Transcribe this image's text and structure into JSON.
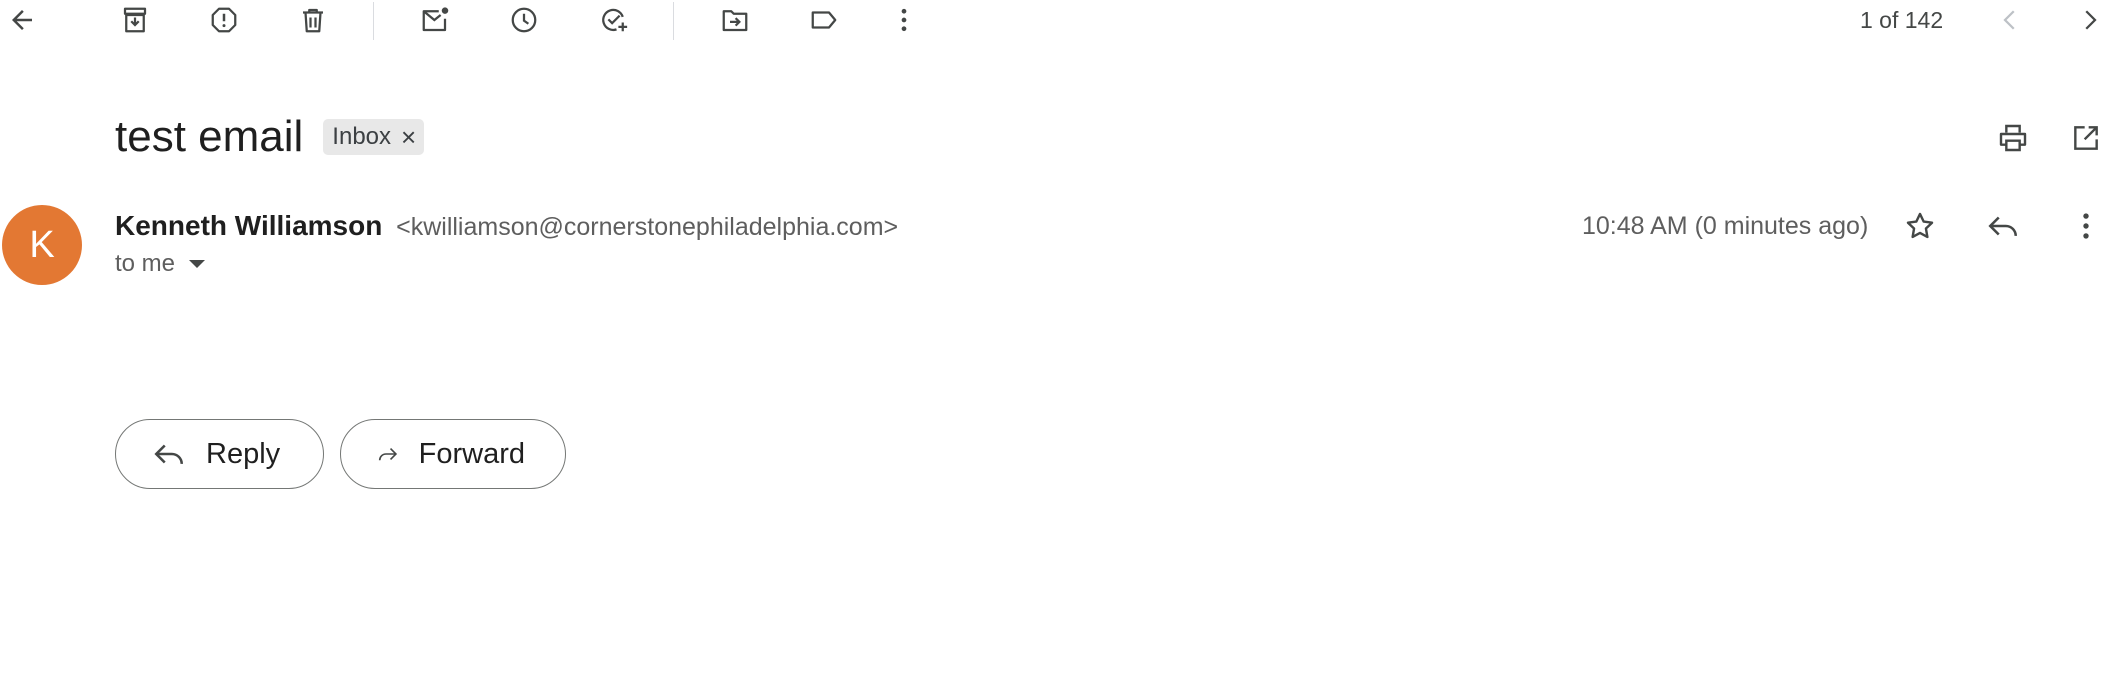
{
  "toolbar": {
    "pager_text": "1 of 142",
    "icons": [
      "back-arrow-icon",
      "archive-icon",
      "report-spam-icon",
      "delete-icon",
      "mark-unread-icon",
      "snooze-icon",
      "add-to-tasks-icon",
      "move-to-icon",
      "label-icon",
      "more-vert-icon",
      "chevron-left-icon",
      "chevron-right-icon"
    ]
  },
  "email": {
    "subject": "test email",
    "label": "Inbox",
    "sender_name": "Kenneth Williamson",
    "sender_email": "<kwilliamson@cornerstonephiladelphia.com>",
    "avatar_letter": "K",
    "recipient": "to me",
    "timestamp": "10:48 AM (0 minutes ago)"
  },
  "actions": {
    "reply_label": "Reply",
    "forward_label": "Forward"
  },
  "colors": {
    "avatar": "#e37833",
    "icon": "#444746",
    "chip_bg": "#e8e8e8"
  }
}
